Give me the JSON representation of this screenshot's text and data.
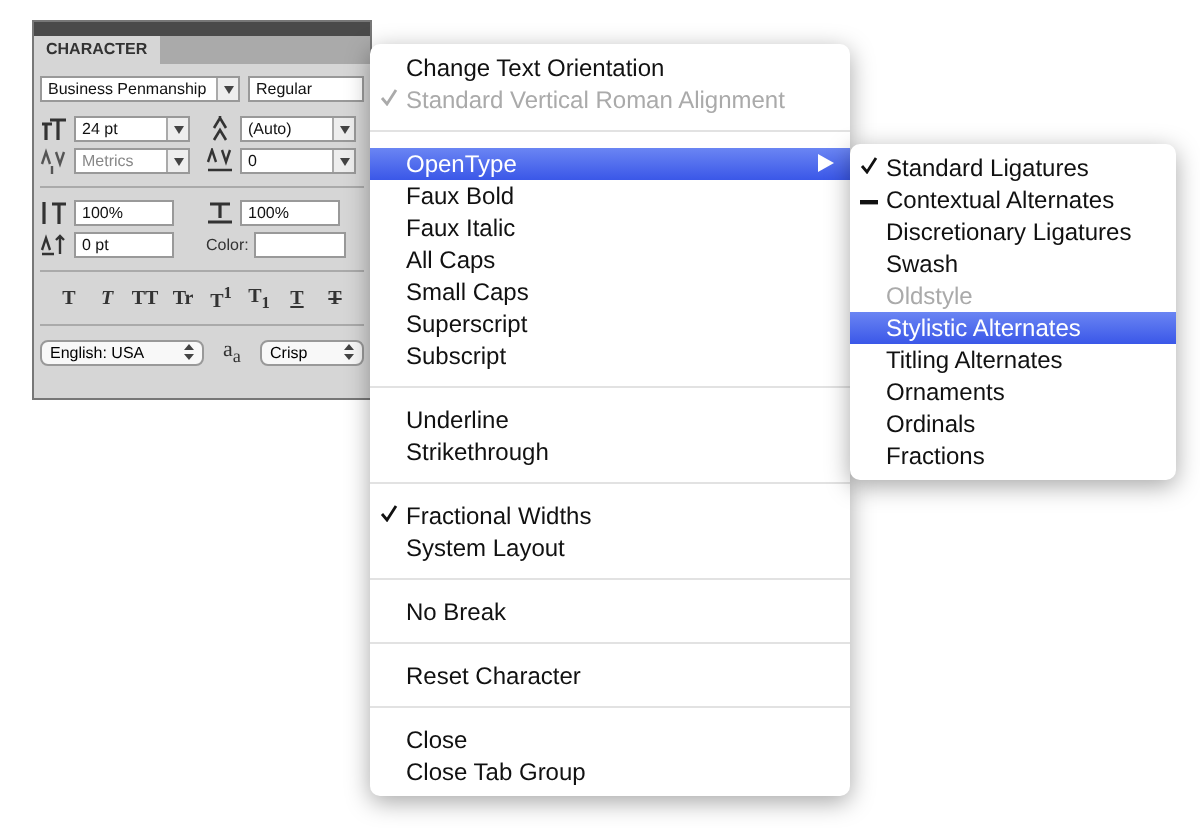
{
  "panel": {
    "tab": "CHARACTER",
    "font_family": "Business Penmanship",
    "font_style": "Regular",
    "fields": [
      {
        "kind": "size",
        "value": "24 pt",
        "dropdown": true,
        "disabled": false
      },
      {
        "kind": "leading",
        "value": "(Auto)",
        "dropdown": true,
        "disabled": false
      },
      {
        "kind": "kerning",
        "value": "Metrics",
        "dropdown": true,
        "disabled": true
      },
      {
        "kind": "tracking",
        "value": "0",
        "dropdown": true,
        "disabled": false
      },
      {
        "kind": "vscale",
        "value": "100%",
        "dropdown": false,
        "disabled": false
      },
      {
        "kind": "hscale",
        "value": "100%",
        "dropdown": false,
        "disabled": false
      },
      {
        "kind": "baseline",
        "value": "0 pt",
        "dropdown": false,
        "disabled": false
      }
    ],
    "color_label": "Color:",
    "style_buttons": [
      {
        "kind": "bold",
        "label": "T"
      },
      {
        "kind": "italic",
        "label": "T"
      },
      {
        "kind": "allcaps",
        "label": "TT"
      },
      {
        "kind": "smallcaps",
        "label": "Tr"
      },
      {
        "kind": "super",
        "label": "T$^{1}$"
      },
      {
        "kind": "sub",
        "label": "T$_{1}$"
      },
      {
        "kind": "underline",
        "label": "T"
      },
      {
        "kind": "strike",
        "label": "T"
      }
    ],
    "language": "English: USA",
    "antialias_icon": "a$_{a}$",
    "antialias": "Crisp"
  },
  "menu": {
    "sections": [
      [
        {
          "label": "Change Text Orientation",
          "checked": false,
          "disabled": false,
          "selected": false,
          "submenu": false
        },
        {
          "label": "Standard Vertical Roman Alignment",
          "checked": true,
          "disabled": true,
          "selected": false,
          "submenu": false
        }
      ],
      [
        {
          "label": "OpenType",
          "checked": false,
          "disabled": false,
          "selected": true,
          "submenu": true
        },
        {
          "label": "Faux Bold",
          "checked": false,
          "disabled": false,
          "selected": false,
          "submenu": false
        },
        {
          "label": "Faux Italic",
          "checked": false,
          "disabled": false,
          "selected": false,
          "submenu": false
        },
        {
          "label": "All Caps",
          "checked": false,
          "disabled": false,
          "selected": false,
          "submenu": false
        },
        {
          "label": "Small Caps",
          "checked": false,
          "disabled": false,
          "selected": false,
          "submenu": false
        },
        {
          "label": "Superscript",
          "checked": false,
          "disabled": false,
          "selected": false,
          "submenu": false
        },
        {
          "label": "Subscript",
          "checked": false,
          "disabled": false,
          "selected": false,
          "submenu": false
        }
      ],
      [
        {
          "label": "Underline",
          "checked": false,
          "disabled": false,
          "selected": false,
          "submenu": false
        },
        {
          "label": "Strikethrough",
          "checked": false,
          "disabled": false,
          "selected": false,
          "submenu": false
        }
      ],
      [
        {
          "label": "Fractional Widths",
          "checked": true,
          "disabled": false,
          "selected": false,
          "submenu": false
        },
        {
          "label": "System Layout",
          "checked": false,
          "disabled": false,
          "selected": false,
          "submenu": false
        }
      ],
      [
        {
          "label": "No Break",
          "checked": false,
          "disabled": false,
          "selected": false,
          "submenu": false
        }
      ],
      [
        {
          "label": "Reset Character",
          "checked": false,
          "disabled": false,
          "selected": false,
          "submenu": false
        }
      ],
      [
        {
          "label": "Close",
          "checked": false,
          "disabled": false,
          "selected": false,
          "submenu": false
        },
        {
          "label": "Close Tab Group",
          "checked": false,
          "disabled": false,
          "selected": false,
          "submenu": false
        }
      ]
    ]
  },
  "submenu": {
    "items": [
      {
        "label": "Standard Ligatures",
        "checked": true,
        "mixed": false,
        "disabled": false,
        "selected": false
      },
      {
        "label": "Contextual Alternates",
        "checked": false,
        "mixed": true,
        "disabled": false,
        "selected": false
      },
      {
        "label": "Discretionary Ligatures",
        "checked": false,
        "mixed": false,
        "disabled": false,
        "selected": false
      },
      {
        "label": "Swash",
        "checked": false,
        "mixed": false,
        "disabled": false,
        "selected": false
      },
      {
        "label": "Oldstyle",
        "checked": false,
        "mixed": false,
        "disabled": true,
        "selected": false
      },
      {
        "label": "Stylistic Alternates",
        "checked": false,
        "mixed": false,
        "disabled": false,
        "selected": true
      },
      {
        "label": "Titling Alternates",
        "checked": false,
        "mixed": false,
        "disabled": false,
        "selected": false
      },
      {
        "label": "Ornaments",
        "checked": false,
        "mixed": false,
        "disabled": false,
        "selected": false
      },
      {
        "label": "Ordinals",
        "checked": false,
        "mixed": false,
        "disabled": false,
        "selected": false
      },
      {
        "label": "Fractions",
        "checked": false,
        "mixed": false,
        "disabled": false,
        "selected": false
      }
    ]
  }
}
